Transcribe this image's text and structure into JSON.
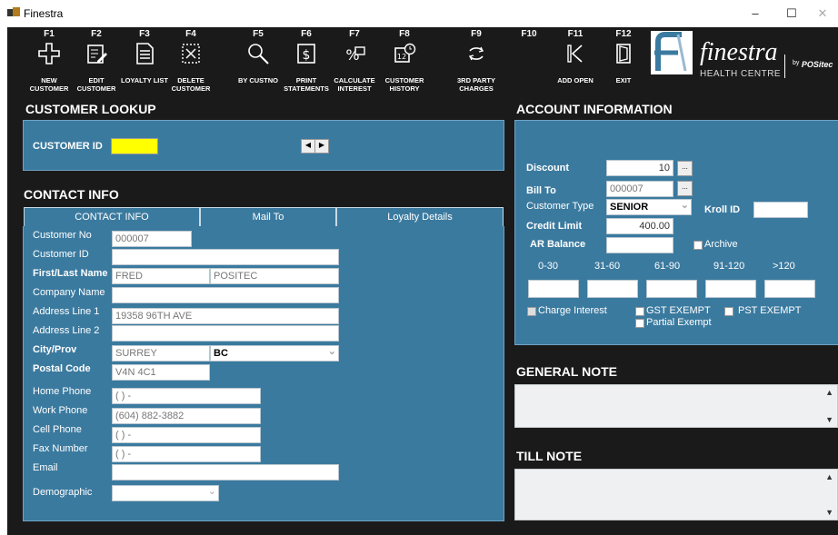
{
  "window": {
    "title": "Finestra",
    "min": "–",
    "max": "☐",
    "close": "✕"
  },
  "toolbar": [
    {
      "key": "F1",
      "label": "NEW CUSTOMER",
      "icon": "plus-icon"
    },
    {
      "key": "F2",
      "label": "EDIT CUSTOMER",
      "icon": "edit-icon"
    },
    {
      "key": "F3",
      "label": "LOYALTY LIST",
      "icon": "list-icon"
    },
    {
      "key": "F4",
      "label": "DELETE CUSTOMER",
      "icon": "delete-icon"
    },
    {
      "key": "F5",
      "label": "BY CUSTNO",
      "icon": "search-icon"
    },
    {
      "key": "F6",
      "label": "PRINT STATEMENTS",
      "icon": "dollar-doc-icon"
    },
    {
      "key": "F7",
      "label": "CALCULATE INTEREST",
      "icon": "percent-icon"
    },
    {
      "key": "F8",
      "label": "CUSTOMER HISTORY",
      "icon": "calendar-clock-icon"
    },
    {
      "key": "F9",
      "label": "3RD PARTY CHARGES",
      "icon": "cycle-icon"
    },
    {
      "key": "F10",
      "label": "",
      "icon": ""
    },
    {
      "key": "F11",
      "label": "ADD OPEN",
      "icon": "skip-back-icon"
    },
    {
      "key": "F12",
      "label": "EXIT",
      "icon": "exit-icon"
    }
  ],
  "logo": {
    "name": "finestra",
    "sub": "HEALTH CENTRE",
    "by": "by",
    "brand": "POSitec"
  },
  "customer_lookup": {
    "title": "CUSTOMER LOOKUP",
    "id_label": "CUSTOMER ID",
    "id_value": ""
  },
  "contact": {
    "title": "CONTACT INFO",
    "tabs": [
      "CONTACT INFO",
      "Mail To",
      "Loyalty Details"
    ],
    "labels": {
      "customer_no": "Customer No",
      "customer_id": "Customer ID",
      "first_last": "First/Last Name",
      "company": "Company Name",
      "addr1": "Address Line 1",
      "addr2": "Address Line 2",
      "city_prov": "City/Prov",
      "postal": "Postal Code",
      "home": "Home Phone",
      "work": "Work Phone",
      "cell": "Cell Phone",
      "fax": "Fax Number",
      "email": "Email",
      "demo": "Demographic"
    },
    "values": {
      "customer_no": "000007",
      "customer_id": "",
      "first": "FRED",
      "last": "POSITEC",
      "company": "",
      "addr1": "19358 96TH AVE",
      "addr2": "",
      "city": "SURREY",
      "prov": "BC",
      "postal": "V4N 4C1",
      "home": "(  )  -",
      "work": "(604) 882-3882",
      "cell": "(  )  -",
      "fax": "(  )  -",
      "email": "",
      "demo": ""
    }
  },
  "account": {
    "title": "ACCOUNT INFORMATION",
    "discount_label": "Discount",
    "discount": "10",
    "bill_to_label": "Bill To",
    "bill_to": "000007",
    "type_label": "Customer Type",
    "type": "SENIOR",
    "kroll_label": "Kroll ID",
    "kroll": "",
    "credit_label": "Credit Limit",
    "credit": "400.00",
    "ar_label": "AR Balance",
    "ar": "",
    "archive_label": "Archive",
    "aging_headers": [
      "0-30",
      "31-60",
      "61-90",
      "91-120",
      ">120"
    ],
    "charge_interest": "Charge Interest",
    "gst_exempt": "GST EXEMPT",
    "pst_exempt": "PST EXEMPT",
    "partial_exempt": "Partial Exempt",
    "ellipsis": "..."
  },
  "general_note": {
    "title": "GENERAL NOTE",
    "text": ""
  },
  "till_note": {
    "title": "TILL NOTE",
    "text": ""
  }
}
